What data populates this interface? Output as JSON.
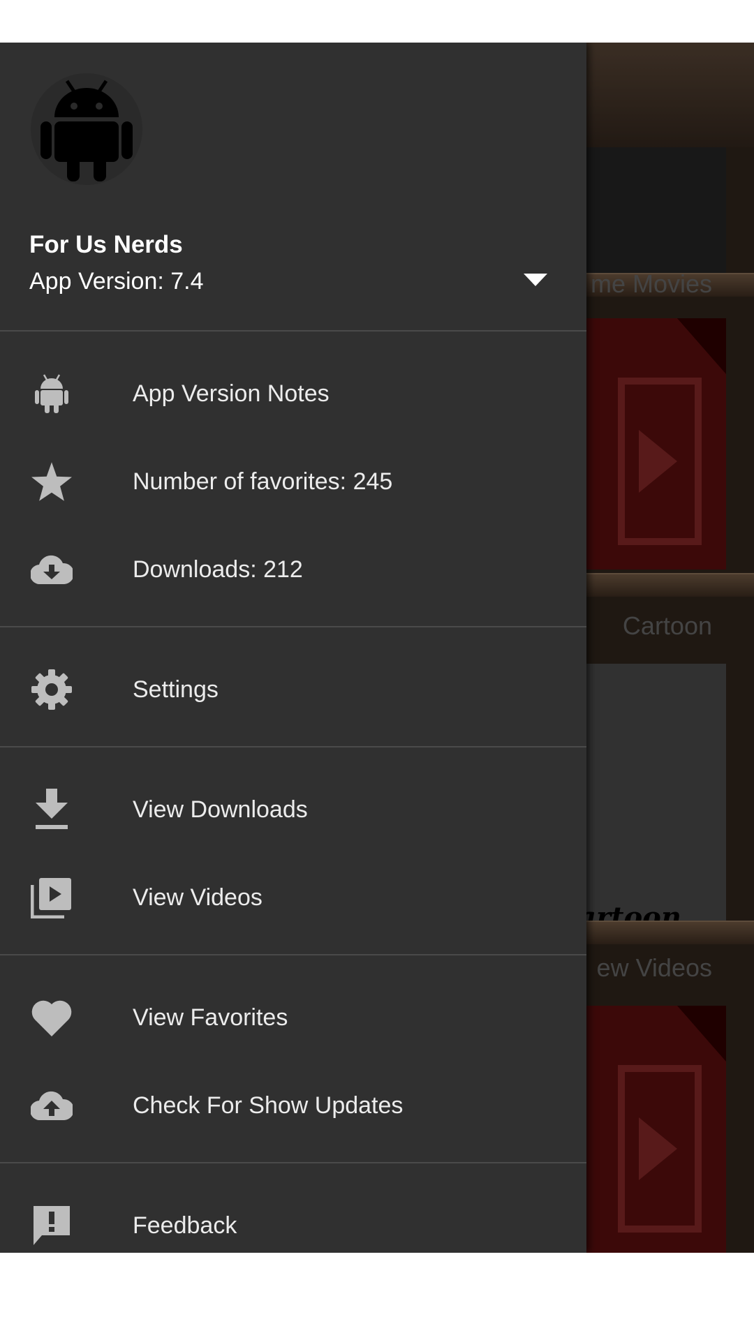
{
  "header": {
    "account_name": "For Us Nerds",
    "account_version": "App Version: 7.4"
  },
  "menu": {
    "app_version_notes": "App Version Notes",
    "favorites": "Number of favorites: 245",
    "downloads": "Downloads: 212",
    "settings": "Settings",
    "view_downloads": "View Downloads",
    "view_videos": "View Videos",
    "view_favorites": "View Favorites",
    "check_updates": "Check For Show Updates",
    "feedback": "Feedback"
  },
  "background": {
    "shelf_titles": [
      "me Movies",
      "Cartoon",
      "ew Videos"
    ],
    "cartoon_tile_text": "artoon"
  },
  "colors": {
    "drawer_bg": "#303030",
    "icon_gray": "#bdbdbd",
    "text": "#ececec",
    "tile_red": "#6d1111"
  },
  "icons": [
    "android-icon",
    "star-icon",
    "cloud-download-icon",
    "gear-icon",
    "download-icon",
    "video-library-icon",
    "heart-icon",
    "cloud-upload-icon",
    "feedback-icon",
    "dropdown-arrow-icon"
  ]
}
